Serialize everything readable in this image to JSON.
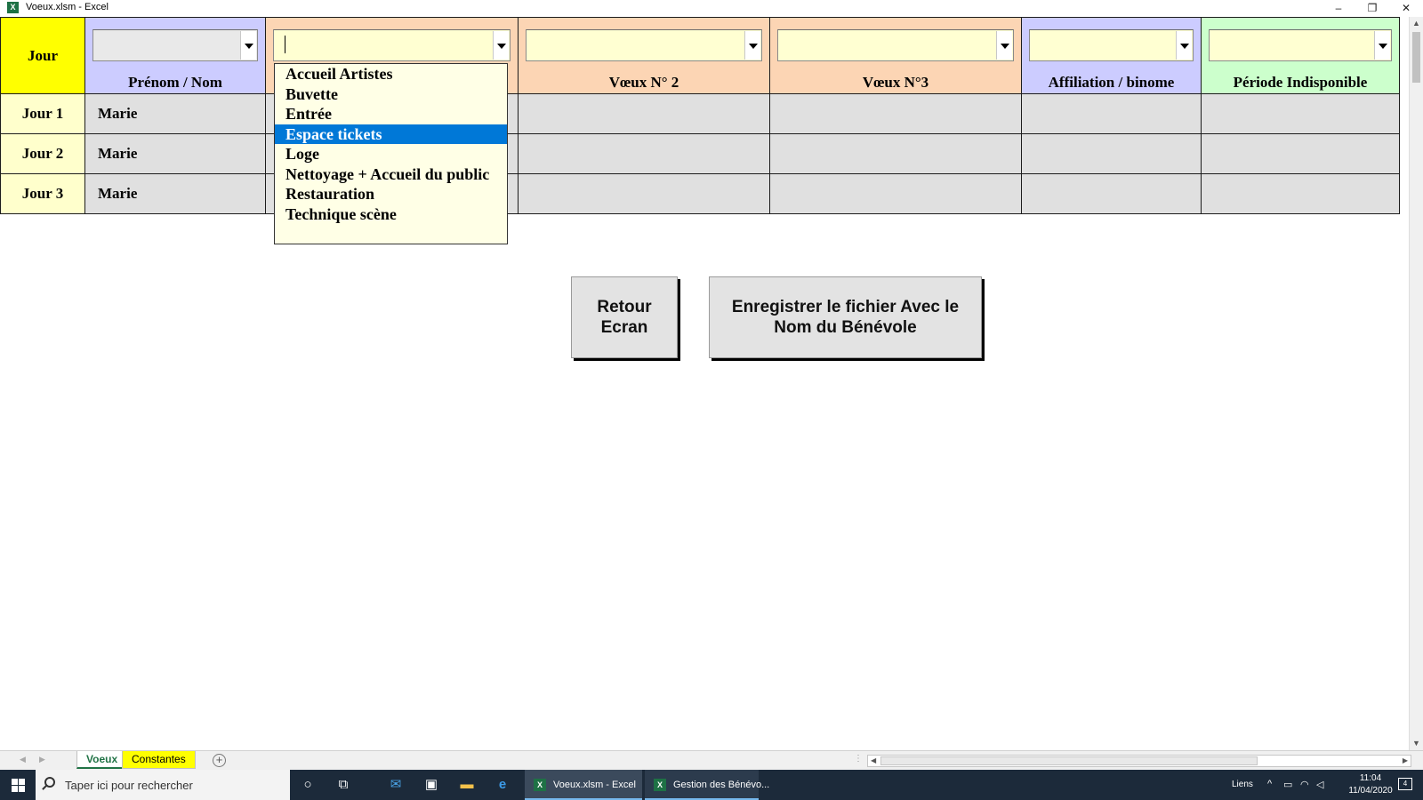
{
  "window": {
    "title": "Voeux.xlsm - Excel",
    "icon": "excel-icon"
  },
  "headers": {
    "jour": "Jour",
    "prenom_nom": "Prénom / Nom",
    "voeux1": "",
    "voeux2": "Vœux N° 2",
    "voeux3": "Vœux N°3",
    "affiliation": "Affiliation / binome",
    "periode": "Période Indisponible"
  },
  "rows": [
    {
      "day": "Jour 1",
      "name": "Marie"
    },
    {
      "day": "Jour 2",
      "name": "Marie"
    },
    {
      "day": "Jour 3",
      "name": "Marie"
    }
  ],
  "dropdown": {
    "options": [
      "Accueil Artistes",
      "Buvette",
      "Entrée",
      "Espace tickets",
      "Loge",
      "Nettoyage + Accueil du public",
      "Restauration",
      "Technique scène"
    ],
    "selected": "Espace tickets"
  },
  "buttons": {
    "retour": "Retour Ecran",
    "save": "Enregistrer le fichier Avec le Nom du Bénévole"
  },
  "sheets": {
    "tabs": [
      "Voeux",
      "Constantes"
    ],
    "active": "Voeux"
  },
  "taskbar": {
    "search_placeholder": "Taper ici pour rechercher",
    "apps": [
      "Voeux.xlsm - Excel",
      "Gestion des Bénévo..."
    ],
    "tray_label": "Liens",
    "time": "11:04",
    "date": "11/04/2020",
    "notifications": "4"
  },
  "colors": {
    "jour_header": "#ffff00",
    "name_header": "#ccccff",
    "voeux_header": "#fcd5b4",
    "periode_header": "#ccffcc",
    "selection": "#0078d7"
  }
}
